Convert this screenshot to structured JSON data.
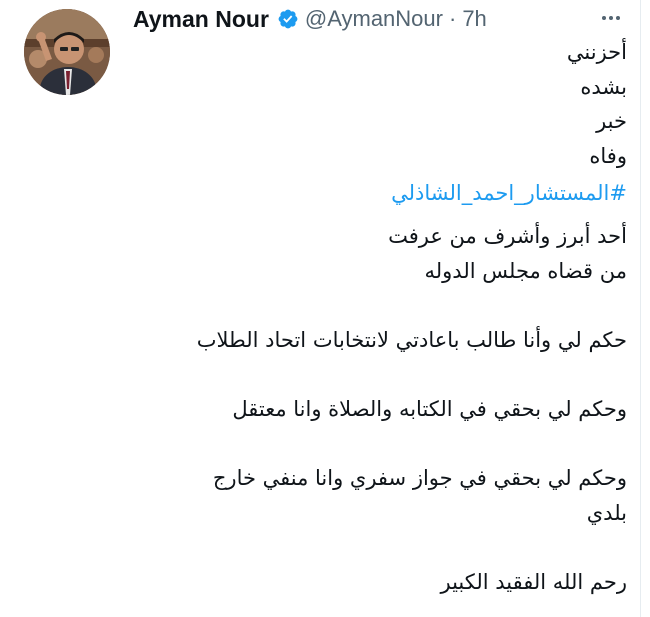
{
  "author": {
    "name": "Ayman Nour",
    "handle": "@AymanNour",
    "separator": "·",
    "time": "7h"
  },
  "icons": {
    "avatar": "profile-photo",
    "verified": "verified-badge-icon",
    "more": "more-options-icon"
  },
  "colors": {
    "hashtag": "#1d9bf0",
    "verified": "#1d9bf0",
    "text": "#0f1419",
    "secondary": "#536471"
  },
  "tweet": {
    "line1": "أحزنني",
    "line2": "بشده",
    "line3": "خبر",
    "line4": "وفاه",
    "hashtag": "#المستشار_احمد_الشاذلي",
    "line5": "أحد أبرز وأشرف من عرفت",
    "line6": "من قضاه مجلس الدوله",
    "line7": "حكم لي وأنا طالب باعادتي لانتخابات اتحاد الطلاب",
    "line8": "وحكم لي بحقي في الكتابه والصلاة وانا معتقل",
    "line9": "وحكم لي بحقي في جواز سفري وانا منفي خارج",
    "line10": "بلدي",
    "line11": "رحم الله الفقيد الكبير"
  }
}
